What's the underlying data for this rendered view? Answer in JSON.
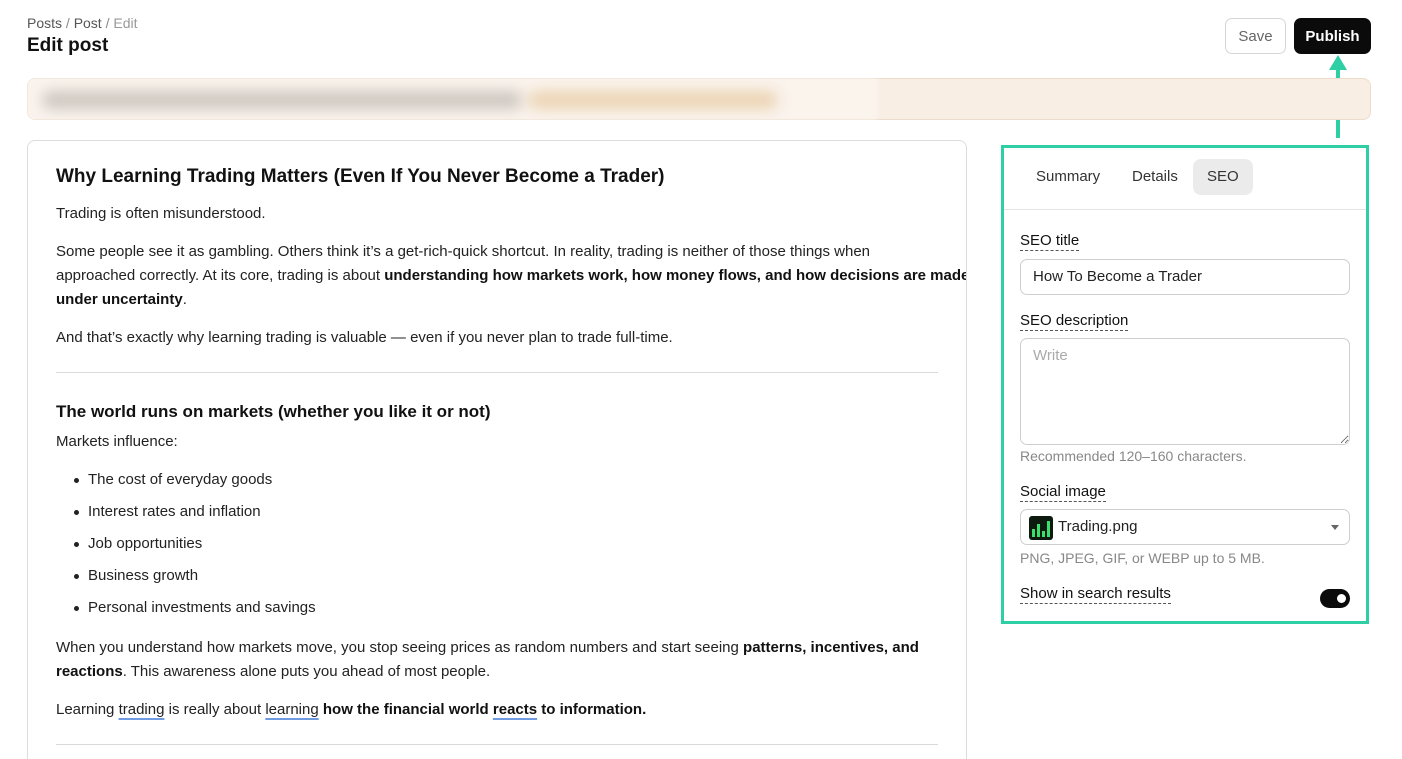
{
  "header": {
    "breadcrumb": [
      "Posts",
      "Post",
      "Edit"
    ],
    "breadcrumb_sep": "/",
    "title": "Edit post",
    "save_label": "Save",
    "publish_label": "Publish"
  },
  "article": {
    "title": "Why Learning Trading Matters (Even If You Never Become a Trader)",
    "p1": "Trading is often misunderstood.",
    "p2_line1": "Some people see it as gambling. Others think it’s a get-rich-quick shortcut. In reality, trading is neither of those things when",
    "p2_line2_plain": "approached correctly. At its core, trading is about ",
    "p2_line2_bold": "understanding how markets work, how money flows, and how decisions are made",
    "p2_line3_bold": "under uncertainty",
    "p2_line3_end": ".",
    "p3": "And that’s exactly why learning trading is valuable — even if you never plan to trade full-time.",
    "h2": "The world runs on markets (whether you like it or not)",
    "p4": "Markets influence:",
    "list": [
      "The cost of everyday goods",
      "Interest rates and inflation",
      "Job opportunities",
      "Business growth",
      "Personal investments and savings"
    ],
    "p5_line1_plain": "When you understand how markets move, you stop seeing prices as random numbers and start seeing ",
    "p5_line1_bold": "patterns, incentives, and",
    "p5_line2_bold": "reactions",
    "p5_line2_end": ". This awareness alone puts you ahead of most people.",
    "p6_w1": "Learning ",
    "p6_w2": "trading",
    "p6_w3": " is really about ",
    "p6_w4": "learning",
    "p6_w5": " how the financial world ",
    "p6_w6": "reacts",
    "p6_w7": " to information."
  },
  "sidebar": {
    "tabs": [
      "Summary",
      "Details",
      "SEO"
    ],
    "active_tab": "SEO",
    "seo_title_label": "SEO title",
    "seo_title_value": "How To Become a Trader",
    "seo_description_label": "SEO description",
    "seo_description_placeholder": "Write",
    "seo_description_help": "Recommended 120–160 characters.",
    "social_image_label": "Social image",
    "social_image_value": "Trading.png",
    "social_image_help": "PNG, JPEG, GIF, or WEBP up to 5 MB.",
    "search_results_label": "Show in search results",
    "search_results_enabled": true
  },
  "colors": {
    "accent_highlight": "#2fcfa5",
    "primary_button": "#0b0b0b",
    "banner_bg": "#f8eee4"
  }
}
